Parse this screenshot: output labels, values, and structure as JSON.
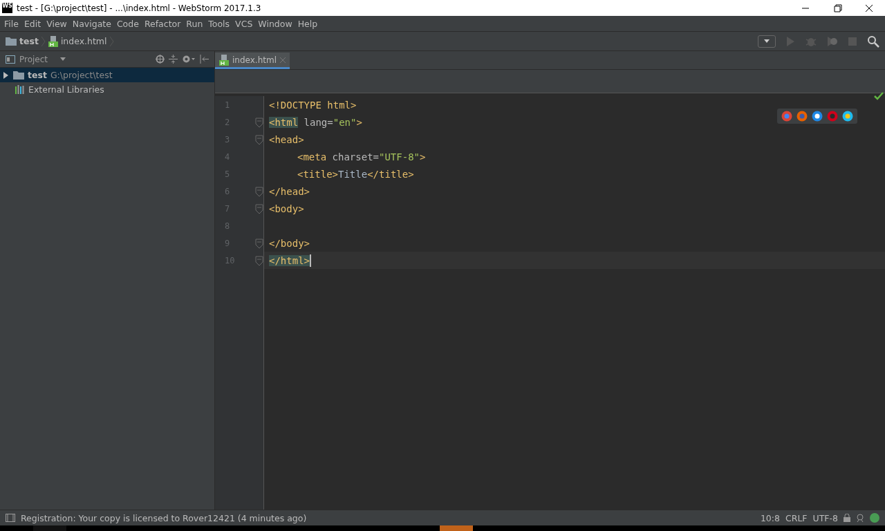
{
  "window": {
    "title": "test - [G:\\project\\test] - ...\\index.html - WebStorm 2017.1.3",
    "logo": "WS"
  },
  "menu": [
    "File",
    "Edit",
    "View",
    "Navigate",
    "Code",
    "Refactor",
    "Run",
    "Tools",
    "VCS",
    "Window",
    "Help"
  ],
  "breadcrumbs": [
    {
      "label": "test",
      "kind": "folder"
    },
    {
      "label": "index.html",
      "kind": "html"
    }
  ],
  "project_panel": {
    "title": "Project",
    "tree": [
      {
        "label": "test",
        "path": "G:\\project\\test",
        "kind": "folder",
        "selected": true,
        "expanded": false
      },
      {
        "label": "External Libraries",
        "kind": "libraries",
        "selected": false
      }
    ]
  },
  "editor_tabs": [
    {
      "label": "index.html",
      "selected": true
    }
  ],
  "code": [
    {
      "number": "1",
      "fold": false,
      "indent": false,
      "current": false,
      "tokens": [
        {
          "kind": "tag",
          "text": "<!DOCTYPE html>"
        }
      ]
    },
    {
      "number": "2",
      "fold": true,
      "indent": false,
      "current": false,
      "tokens": [
        {
          "kind": "match",
          "text": "<html"
        },
        {
          "kind": "attr",
          "text": " lang="
        },
        {
          "kind": "value",
          "text": "\"en\""
        },
        {
          "kind": "tag",
          "text": ">"
        }
      ]
    },
    {
      "number": "3",
      "fold": true,
      "indent": false,
      "current": false,
      "tokens": [
        {
          "kind": "tag",
          "text": "<head>"
        }
      ]
    },
    {
      "number": "4",
      "fold": false,
      "indent": true,
      "current": false,
      "tokens": [
        {
          "kind": "tag",
          "text": "<meta"
        },
        {
          "kind": "attr",
          "text": " charset="
        },
        {
          "kind": "value",
          "text": "\"UTF-8\""
        },
        {
          "kind": "tag",
          "text": ">"
        }
      ]
    },
    {
      "number": "5",
      "fold": false,
      "indent": true,
      "current": false,
      "tokens": [
        {
          "kind": "tag",
          "text": "<title>"
        },
        {
          "kind": "text",
          "text": "Title"
        },
        {
          "kind": "tag",
          "text": "</title>"
        }
      ]
    },
    {
      "number": "6",
      "fold": true,
      "indent": false,
      "current": false,
      "tokens": [
        {
          "kind": "tag",
          "text": "</head>"
        }
      ]
    },
    {
      "number": "7",
      "fold": true,
      "indent": false,
      "current": false,
      "tokens": [
        {
          "kind": "tag",
          "text": "<body>"
        }
      ]
    },
    {
      "number": "8",
      "fold": false,
      "current": false
    },
    {
      "number": "9",
      "fold": true,
      "indent": false,
      "current": false,
      "tokens": [
        {
          "kind": "tag",
          "text": "</body>"
        }
      ]
    },
    {
      "number": "10",
      "fold": true,
      "indent": false,
      "current": true,
      "tokens": [
        {
          "kind": "match",
          "text": "</html>"
        }
      ]
    }
  ],
  "status_bar": {
    "message": "Registration: Your copy is licensed to Rover12421 (4 minutes ago)",
    "position": "10:8",
    "line_separator": "CRLF",
    "encoding": "UTF-8"
  }
}
